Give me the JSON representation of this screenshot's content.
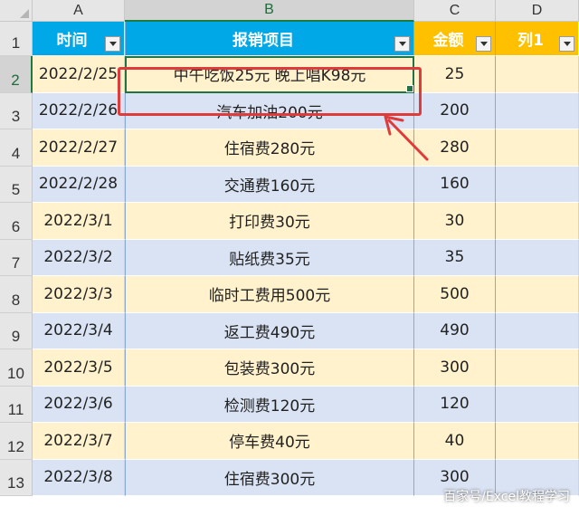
{
  "column_headers": [
    "A",
    "B",
    "C",
    "D"
  ],
  "table": {
    "headers": [
      "时间",
      "报销项目",
      "金额",
      "列1"
    ],
    "rows": [
      {
        "row_number": "2",
        "date": "2022/2/25",
        "item": "中午吃饭25元 晚上唱K98元",
        "amount": "25",
        "col1": ""
      },
      {
        "row_number": "3",
        "date": "2022/2/26",
        "item": "汽车加油200元",
        "amount": "200",
        "col1": ""
      },
      {
        "row_number": "4",
        "date": "2022/2/27",
        "item": "住宿费280元",
        "amount": "280",
        "col1": ""
      },
      {
        "row_number": "5",
        "date": "2022/2/28",
        "item": "交通费160元",
        "amount": "160",
        "col1": ""
      },
      {
        "row_number": "6",
        "date": "2022/3/1",
        "item": "打印费30元",
        "amount": "30",
        "col1": ""
      },
      {
        "row_number": "7",
        "date": "2022/3/2",
        "item": "贴纸费35元",
        "amount": "35",
        "col1": ""
      },
      {
        "row_number": "8",
        "date": "2022/3/3",
        "item": "临时工费用500元",
        "amount": "500",
        "col1": ""
      },
      {
        "row_number": "9",
        "date": "2022/3/4",
        "item": "返工费490元",
        "amount": "490",
        "col1": ""
      },
      {
        "row_number": "10",
        "date": "2022/3/5",
        "item": "包装费300元",
        "amount": "300",
        "col1": ""
      },
      {
        "row_number": "11",
        "date": "2022/3/6",
        "item": "检测费120元",
        "amount": "120",
        "col1": ""
      },
      {
        "row_number": "12",
        "date": "2022/3/7",
        "item": "停车费40元",
        "amount": "40",
        "col1": ""
      },
      {
        "row_number": "13",
        "date": "2022/3/8",
        "item": "住宿费300元",
        "amount": "300",
        "col1": ""
      }
    ]
  },
  "header_row_number": "1",
  "watermark": "百家号/Excel教程学习",
  "colors": {
    "header_blue": "#00a8e8",
    "header_orange": "#ffc000",
    "band_odd": "#fff2cc",
    "band_even": "#dae3f3",
    "selection": "#217346",
    "annotation_red": "#e03b3b"
  }
}
